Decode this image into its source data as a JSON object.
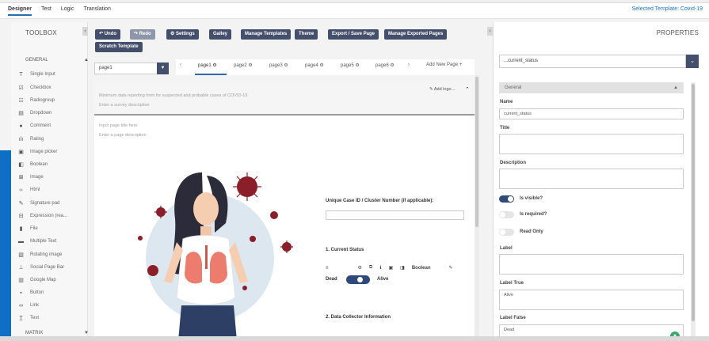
{
  "app": {
    "tabs": [
      "Designer",
      "Test",
      "Logic",
      "Translation"
    ],
    "selected_template": "Selected Template: Covid-19"
  },
  "toolbox": {
    "title": "TOOLBOX",
    "general_label": "GENERAL",
    "matrix_label": "MATRIX",
    "items": [
      {
        "label": "Single Input",
        "icon": "text-input-icon"
      },
      {
        "label": "Checkbox",
        "icon": "checkbox-icon"
      },
      {
        "label": "Radiogroup",
        "icon": "radiogroup-icon"
      },
      {
        "label": "Dropdown",
        "icon": "dropdown-icon"
      },
      {
        "label": "Comment",
        "icon": "comment-icon"
      },
      {
        "label": "Rating",
        "icon": "rating-icon"
      },
      {
        "label": "Image picker",
        "icon": "image-picker-icon"
      },
      {
        "label": "Boolean",
        "icon": "boolean-icon"
      },
      {
        "label": "Image",
        "icon": "image-icon"
      },
      {
        "label": "Html",
        "icon": "code-icon"
      },
      {
        "label": "Signature pad",
        "icon": "signature-icon"
      },
      {
        "label": "Expression (rea...",
        "icon": "expression-icon"
      },
      {
        "label": "File",
        "icon": "file-icon"
      },
      {
        "label": "Multiple Text",
        "icon": "multiple-text-icon"
      },
      {
        "label": "Rotating image",
        "icon": "rotating-image-icon"
      },
      {
        "label": "Social Page Bar",
        "icon": "social-page-bar-icon"
      },
      {
        "label": "Google Map",
        "icon": "map-icon"
      },
      {
        "label": "Button",
        "icon": "button-icon"
      },
      {
        "label": "Link",
        "icon": "link-icon"
      },
      {
        "label": "Text",
        "icon": "text-icon"
      }
    ]
  },
  "toolbar": {
    "undo": "Undo",
    "redo": "Redo",
    "settings": "Settings",
    "galley": "Galley",
    "manage_templates": "Manage Templates",
    "theme": "Theme",
    "export_save": "Export / Save Page",
    "manage_exported": "Manage Exported Pages",
    "scratch": "Scratch Template"
  },
  "pages": {
    "selected": "page1",
    "tabs": [
      "page1",
      "page2",
      "page3",
      "page4",
      "page5",
      "page6"
    ],
    "add_new": "Add New Page"
  },
  "survey": {
    "description": "Minimum data reporting form for suspected and probable cases of COVID-19",
    "survey_desc_placeholder": "Enter a survey description",
    "add_logo": "Add logo...",
    "page_title_placeholder": "Input page title here",
    "page_desc_placeholder": "Enter a page description",
    "q_case_id": "Unique Case ID / Cluster Number (if applicable):",
    "q_current_status": "1. Current Status",
    "boolean_tag": "Boolean",
    "label_false": "Dead",
    "label_true": "Alive",
    "q_data_collector": "2. Data Collector Information"
  },
  "properties": {
    "title": "PROPERTIES",
    "selected_object": "...current_status",
    "section_general": "General",
    "name_label": "Name",
    "name_value": "current_status",
    "title_label": "Title",
    "description_label": "Description",
    "is_visible": "Is visible?",
    "is_required": "Is required?",
    "read_only": "Read Only",
    "label_label": "Label",
    "label_true_label": "Label True",
    "label_true_value": "Alive",
    "label_false_label": "Label False",
    "label_false_value": "Dead"
  }
}
